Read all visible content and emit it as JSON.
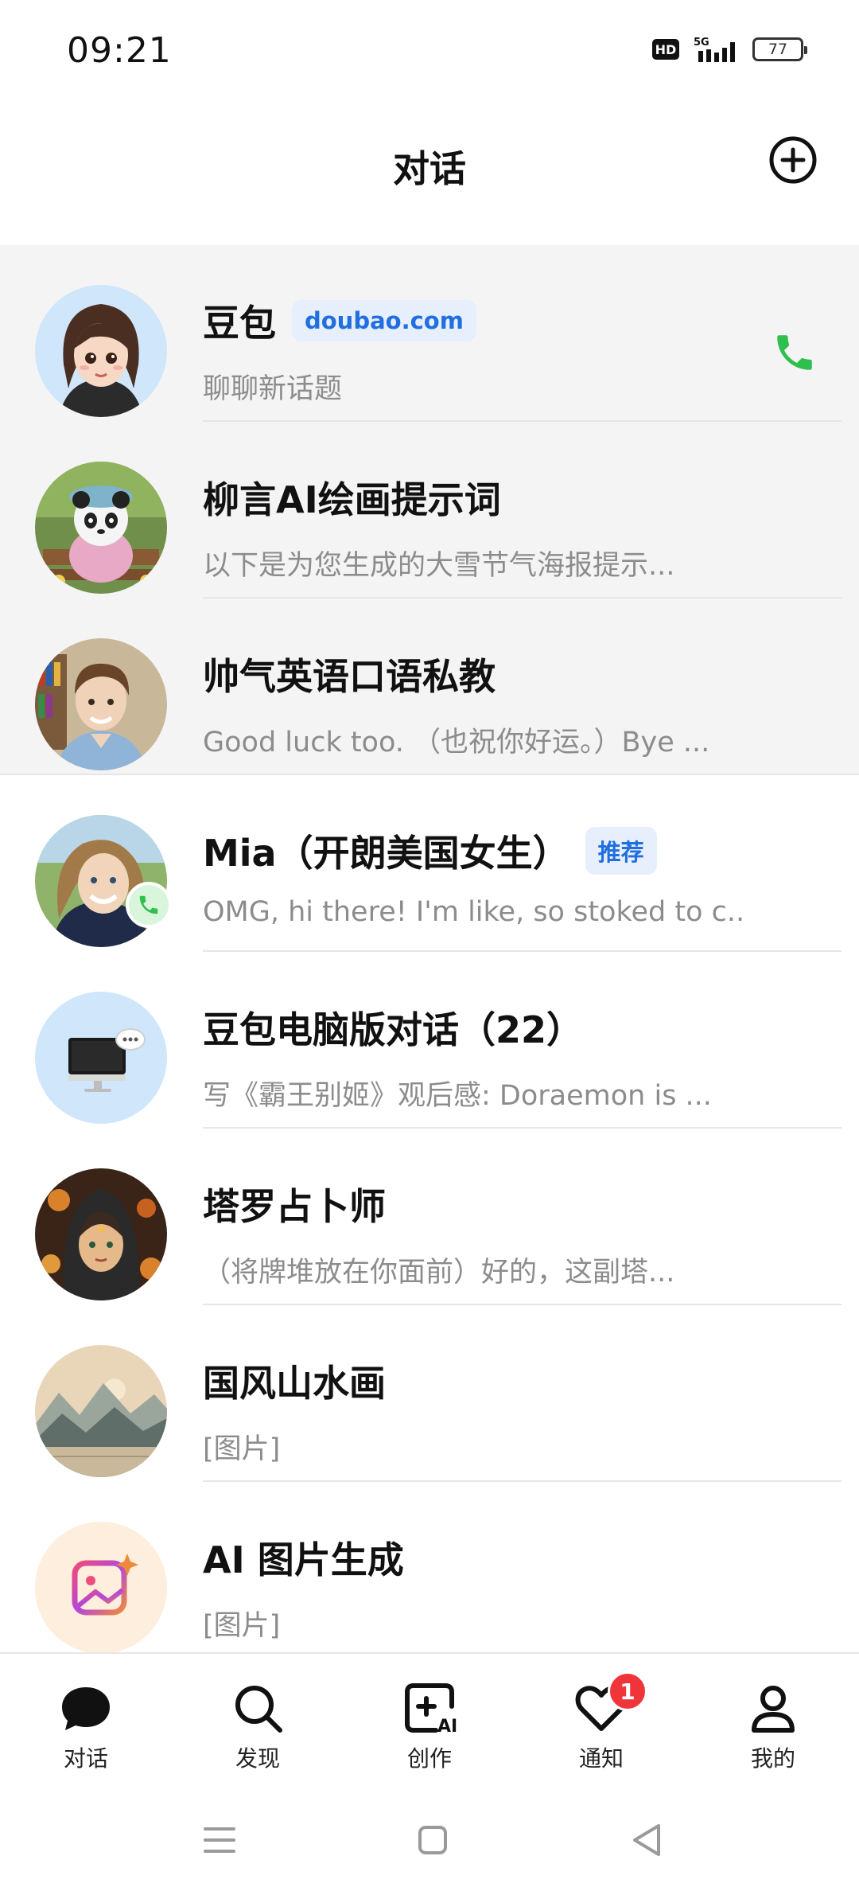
{
  "status_bar": {
    "time": "09:21",
    "hd_label": "HD",
    "network_label": "5G",
    "battery": "77"
  },
  "header": {
    "title": "对话",
    "add_icon": "plus-circle-icon"
  },
  "conversations": [
    {
      "name": "豆包",
      "tag": "doubao.com",
      "preview": "聊聊新话题",
      "pinned": true,
      "has_call": true
    },
    {
      "name": "柳言AI绘画提示词",
      "tag": "",
      "preview": "以下是为您生成的大雪节气海报提示...",
      "pinned": true
    },
    {
      "name": "帅气英语口语私教",
      "tag": "",
      "preview": "Good luck too. （也祝你好运。）Bye ...",
      "pinned": true
    },
    {
      "name": "Mia（开朗美国女生）",
      "tag": "推荐",
      "preview": "OMG, hi there! I'm like, so stoked to c...",
      "pinned": false,
      "has_call_badge": true
    },
    {
      "name": "豆包电脑版对话（22）",
      "tag": "",
      "preview": "写《霸王别姬》观后感: Doraemon is ...",
      "pinned": false
    },
    {
      "name": "塔罗占卜师",
      "tag": "",
      "preview": "（将牌堆放在你面前）好的，这副塔...",
      "pinned": false
    },
    {
      "name": "国风山水画",
      "tag": "",
      "preview": "[图片]",
      "pinned": false
    },
    {
      "name": "AI 图片生成",
      "tag": "",
      "preview": "[图片]",
      "pinned": false
    }
  ],
  "bottom_nav": [
    {
      "label": "对话",
      "icon": "chat-bubble-icon",
      "active": true
    },
    {
      "label": "发现",
      "icon": "search-icon"
    },
    {
      "label": "创作",
      "icon": "create-ai-icon",
      "icon_text": "AI"
    },
    {
      "label": "通知",
      "icon": "heart-icon",
      "badge": "1"
    },
    {
      "label": "我的",
      "icon": "person-icon"
    }
  ],
  "system_nav": [
    "menu-icon",
    "home-icon",
    "back-icon"
  ],
  "colors": {
    "accent_blue": "#1f6fe0",
    "call_green": "#2fbf4f",
    "badge_red": "#f0353a",
    "pinned_bg": "#f4f4f4"
  }
}
